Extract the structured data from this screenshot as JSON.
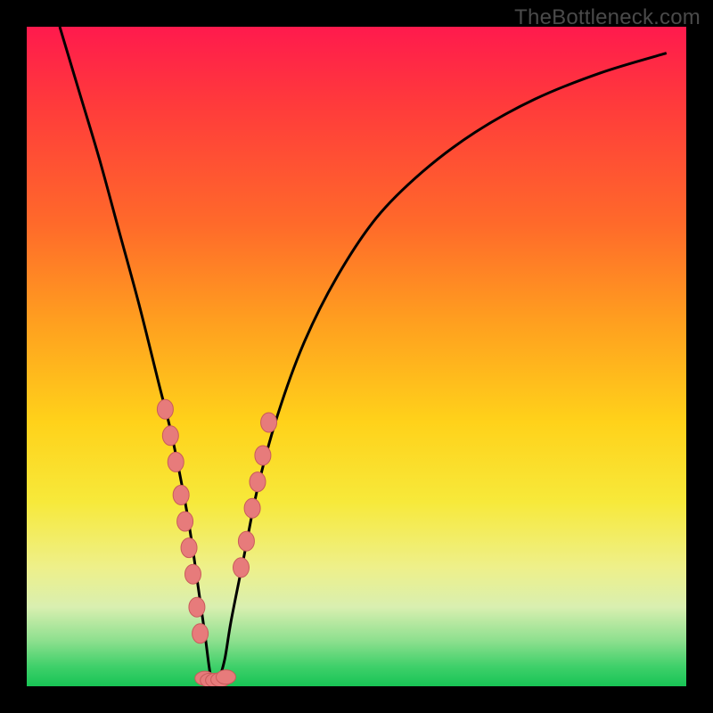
{
  "watermark": "TheBottleneck.com",
  "colors": {
    "frame": "#000000",
    "curve": "#000000",
    "marker_fill": "#e77b7b",
    "marker_stroke": "#c95b5b"
  },
  "chart_data": {
    "type": "line",
    "title": "",
    "xlabel": "",
    "ylabel": "",
    "xlim": [
      0,
      100
    ],
    "ylim": [
      0,
      100
    ],
    "note": "Rainbow gradient background from red (top, high bottleneck) to green (bottom, low bottleneck). Black V-like curve with a minimum near x≈28. Pink markers cluster around the valley on both branches.",
    "series": [
      {
        "name": "bottleneck-curve",
        "x": [
          5,
          8,
          11,
          14,
          17,
          20,
          22,
          24,
          25,
          26,
          27,
          28,
          29,
          30,
          31,
          33,
          35,
          38,
          42,
          47,
          53,
          60,
          68,
          77,
          87,
          97
        ],
        "y": [
          100,
          90,
          80,
          69,
          58,
          46,
          38,
          28,
          22,
          15,
          8,
          1,
          1,
          4,
          10,
          20,
          30,
          41,
          52,
          62,
          71,
          78,
          84,
          89,
          93,
          96
        ]
      },
      {
        "name": "left-branch-markers",
        "x": [
          21.0,
          21.8,
          22.6,
          23.4,
          24.0,
          24.6,
          25.2,
          25.8,
          26.3
        ],
        "y": [
          42.0,
          38.0,
          34.0,
          29.0,
          25.0,
          21.0,
          17.0,
          12.0,
          8.0
        ]
      },
      {
        "name": "right-branch-markers",
        "x": [
          32.5,
          33.3,
          34.2,
          35.0,
          35.8,
          36.7
        ],
        "y": [
          18.0,
          22.0,
          27.0,
          31.0,
          35.0,
          40.0
        ]
      },
      {
        "name": "valley-markers",
        "x": [
          27.0,
          27.8,
          28.6,
          29.4,
          30.2
        ],
        "y": [
          1.2,
          0.9,
          0.9,
          1.0,
          1.4
        ]
      }
    ]
  }
}
